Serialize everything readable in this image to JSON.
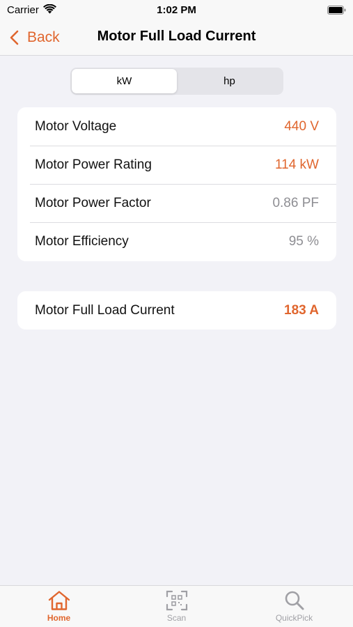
{
  "status": {
    "carrier": "Carrier",
    "time": "1:02 PM"
  },
  "nav": {
    "back_label": "Back",
    "title": "Motor Full Load Current"
  },
  "segmented": {
    "options": [
      "kW",
      "hp"
    ],
    "selected": "kW"
  },
  "inputs": [
    {
      "label": "Motor Voltage",
      "value": "440 V"
    },
    {
      "label": "Motor Power Rating",
      "value": "114 kW"
    },
    {
      "label": "Motor Power Factor",
      "value": "0.86 PF"
    },
    {
      "label": "Motor Efficiency",
      "value": "95 %"
    }
  ],
  "result": {
    "label": "Motor Full Load Current",
    "value": "183 A"
  },
  "tabs": [
    {
      "label": "Home",
      "icon": "home-icon"
    },
    {
      "label": "Scan",
      "icon": "scan-icon"
    },
    {
      "label": "QuickPick",
      "icon": "search-icon"
    }
  ],
  "colors": {
    "accent": "#e0662e",
    "inactive": "#a0a0a5",
    "background": "#f2f2f7"
  }
}
